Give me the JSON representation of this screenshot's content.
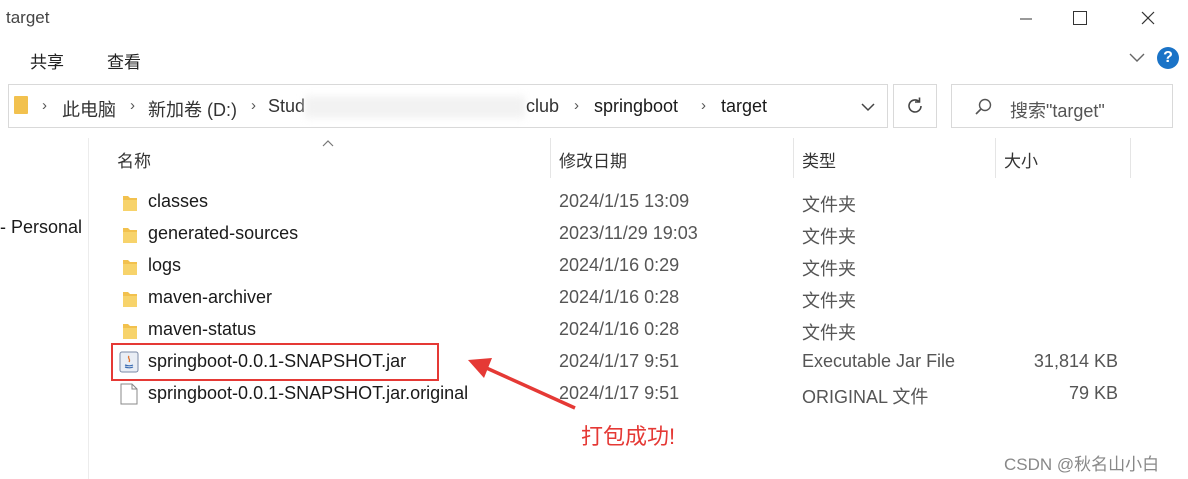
{
  "window": {
    "title": "target"
  },
  "ribbon": {
    "tabs": [
      "共享",
      "查看"
    ]
  },
  "address": {
    "crumbs": [
      "此电脑",
      "新加卷 (D:)",
      "Stud",
      "club",
      "springboot",
      "target"
    ],
    "search_placeholder": "搜索\"target\""
  },
  "nav": {
    "partial_item": "- Personal"
  },
  "columns": {
    "name": "名称",
    "modified": "修改日期",
    "type": "类型",
    "size": "大小"
  },
  "files": [
    {
      "name": "classes",
      "modified": "2024/1/15 13:09",
      "type": "文件夹",
      "size": "",
      "icon": "folder-icon"
    },
    {
      "name": "generated-sources",
      "modified": "2023/11/29 19:03",
      "type": "文件夹",
      "size": "",
      "icon": "folder-icon"
    },
    {
      "name": "logs",
      "modified": "2024/1/16 0:29",
      "type": "文件夹",
      "size": "",
      "icon": "folder-icon"
    },
    {
      "name": "maven-archiver",
      "modified": "2024/1/16 0:28",
      "type": "文件夹",
      "size": "",
      "icon": "folder-icon"
    },
    {
      "name": "maven-status",
      "modified": "2024/1/16 0:28",
      "type": "文件夹",
      "size": "",
      "icon": "folder-icon"
    },
    {
      "name": "springboot-0.0.1-SNAPSHOT.jar",
      "modified": "2024/1/17 9:51",
      "type": "Executable Jar File",
      "size": "31,814 KB",
      "icon": "jar-icon"
    },
    {
      "name": "springboot-0.0.1-SNAPSHOT.jar.original",
      "modified": "2024/1/17 9:51",
      "type": "ORIGINAL 文件",
      "size": "79 KB",
      "icon": "file-icon"
    }
  ],
  "annotation": {
    "text": "打包成功!",
    "color": "#e53935"
  },
  "watermark": {
    "text": "CSDN @秋名山小白"
  },
  "colors": {
    "folder": "#f2c14e",
    "accent": "#1a73c7",
    "annotation": "#e53935"
  }
}
